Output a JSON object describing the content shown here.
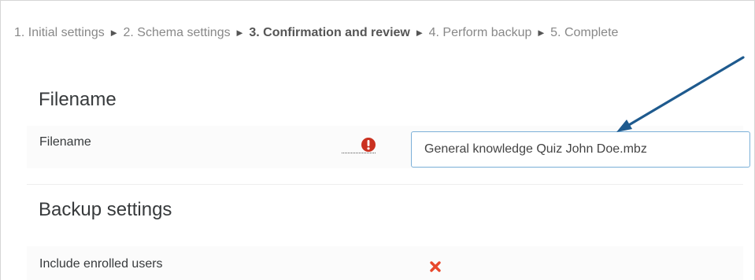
{
  "progress": {
    "steps": [
      {
        "label": "1. Initial settings"
      },
      {
        "label": "2. Schema settings"
      },
      {
        "label": "3. Confirmation and review"
      },
      {
        "label": "4. Perform backup"
      },
      {
        "label": "5. Complete"
      }
    ],
    "separator": "►"
  },
  "filename_section": {
    "heading": "Filename",
    "field_label": "Filename",
    "required_icon": "exclamation-circle-icon",
    "value": "General knowledge Quiz John Doe.mbz"
  },
  "backup_settings": {
    "heading": "Backup settings",
    "include_enrolled_users": {
      "label": "Include enrolled users",
      "status_icon": "cross-icon"
    }
  },
  "colors": {
    "required_icon": "#ca3120",
    "cross_icon": "#e8482c",
    "input_border": "#7bb0d8",
    "annotation_arrow": "#1e5a8e"
  }
}
